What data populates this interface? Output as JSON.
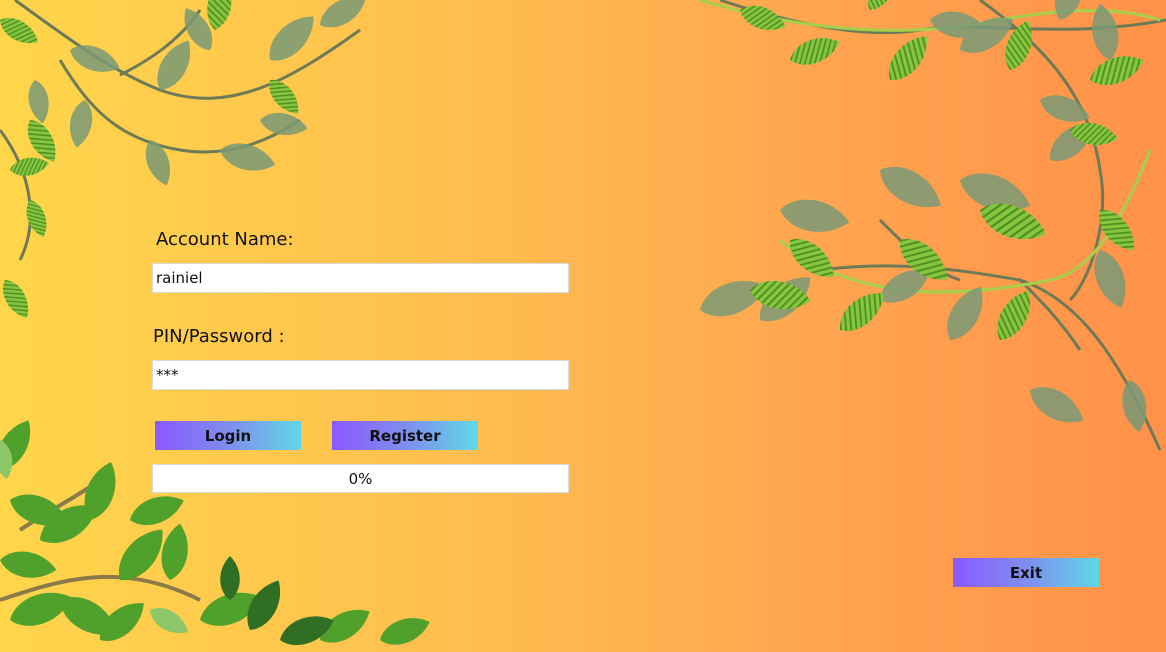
{
  "login_form": {
    "account_name_label": "Account Name:",
    "account_name_value": "rainiel",
    "pin_label": "PIN/Password :",
    "pin_value": "***",
    "login_button": "Login",
    "register_button": "Register",
    "progress": {
      "value_percent": 0,
      "text": "0%"
    }
  },
  "exit_button": "Exit",
  "colors": {
    "background_start": "#ffd64a",
    "background_end": "#ff9149",
    "button_gradient_start": "#8b59ff",
    "button_gradient_end": "#5fd8e8"
  }
}
